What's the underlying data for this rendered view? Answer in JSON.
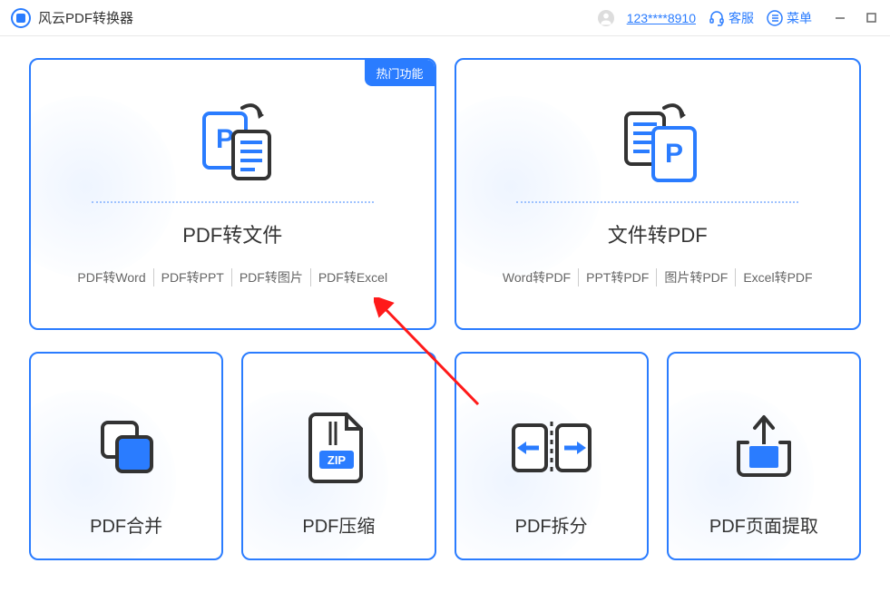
{
  "app": {
    "title": "风云PDF转换器"
  },
  "header": {
    "user_id": "123****8910",
    "customer_service": "客服",
    "menu": "菜单"
  },
  "cards": {
    "pdf_to_file": {
      "badge": "热门功能",
      "title": "PDF转文件",
      "sub": [
        "PDF转Word",
        "PDF转PPT",
        "PDF转图片",
        "PDF转Excel"
      ]
    },
    "file_to_pdf": {
      "title": "文件转PDF",
      "sub": [
        "Word转PDF",
        "PPT转PDF",
        "图片转PDF",
        "Excel转PDF"
      ]
    },
    "pdf_merge": {
      "title": "PDF合并"
    },
    "pdf_compress": {
      "title": "PDF压缩",
      "zip_label": "ZIP"
    },
    "pdf_split": {
      "title": "PDF拆分"
    },
    "pdf_extract": {
      "title": "PDF页面提取"
    }
  }
}
